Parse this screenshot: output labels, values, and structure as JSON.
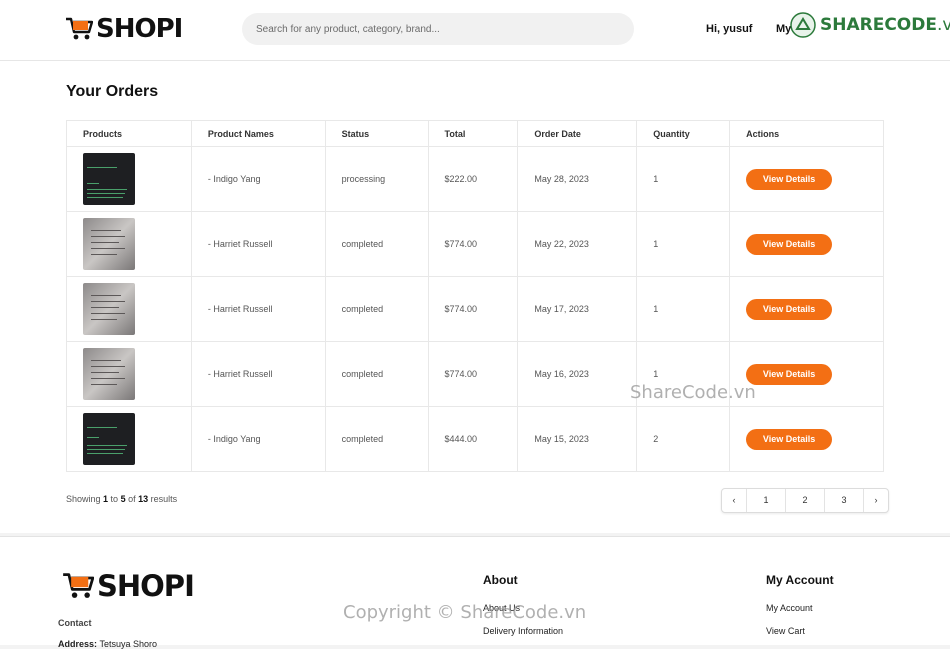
{
  "header": {
    "logo_text": "SHOPI",
    "search_placeholder": "Search for any product, category, brand...",
    "greeting": "Hi, yusuf",
    "my_label": "My",
    "sharecode_logo": {
      "brand": "SHARECODE",
      "suffix": ".vn"
    }
  },
  "main": {
    "title": "Your Orders",
    "columns": [
      "Products",
      "Product Names",
      "Status",
      "Total",
      "Order Date",
      "Quantity",
      "Actions"
    ],
    "orders": [
      {
        "thumb": "dark",
        "name": "- Indigo Yang",
        "status": "processing",
        "total": "$222.00",
        "date": "May 28, 2023",
        "qty": "1",
        "action": "View Details"
      },
      {
        "thumb": "paper",
        "name": "- Harriet Russell",
        "status": "completed",
        "total": "$774.00",
        "date": "May 22, 2023",
        "qty": "1",
        "action": "View Details"
      },
      {
        "thumb": "paper",
        "name": "- Harriet Russell",
        "status": "completed",
        "total": "$774.00",
        "date": "May 17, 2023",
        "qty": "1",
        "action": "View Details"
      },
      {
        "thumb": "paper",
        "name": "- Harriet Russell",
        "status": "completed",
        "total": "$774.00",
        "date": "May 16, 2023",
        "qty": "1",
        "action": "View Details"
      },
      {
        "thumb": "dark",
        "name": "- Indigo Yang",
        "status": "completed",
        "total": "$444.00",
        "date": "May 15, 2023",
        "qty": "2",
        "action": "View Details"
      }
    ],
    "pagination": {
      "showing_prefix": "Showing ",
      "from": "1",
      "to_word": " to ",
      "to": "5",
      "of_word": " of ",
      "total": "13",
      "suffix": " results",
      "pages": [
        "1",
        "2",
        "3"
      ],
      "prev_icon": "‹",
      "next_icon": "›"
    }
  },
  "footer": {
    "logo_text": "SHOPI",
    "contact_label": "Contact",
    "address_label": "Address:",
    "address_value": "Tetsuya Shoro",
    "about_heading": "About",
    "about_links": [
      "About Us",
      "Delivery Information"
    ],
    "account_heading": "My Account",
    "account_links": [
      "My Account",
      "View Cart"
    ]
  },
  "watermarks": {
    "center": "ShareCode.vn",
    "bottom": "Copyright © ShareCode.vn"
  },
  "colors": {
    "accent": "#f36f14",
    "sharecode_green": "#2c7a3b"
  }
}
